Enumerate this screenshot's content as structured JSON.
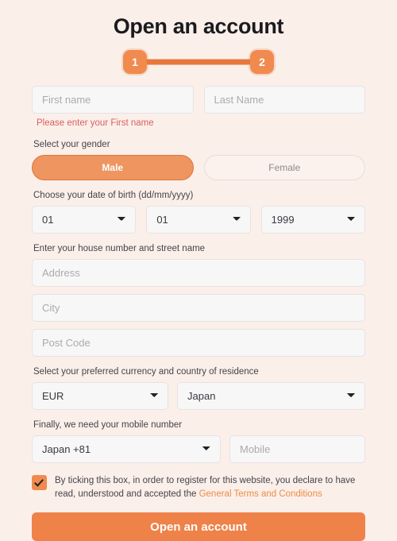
{
  "page": {
    "title": "Open an account",
    "background_color": "#FBEFEA",
    "accent_color": "#EE8248"
  },
  "stepper": {
    "steps": [
      {
        "number": "1",
        "state": "active"
      },
      {
        "number": "2",
        "state": "active"
      }
    ]
  },
  "name_section": {
    "first_name": {
      "placeholder": "First name",
      "value": ""
    },
    "last_name": {
      "placeholder": "Last Name",
      "value": ""
    },
    "error": "Please enter your First name",
    "error_color": "#D9605E"
  },
  "gender_section": {
    "label": "Select your gender",
    "options": [
      {
        "label": "Male",
        "selected": true
      },
      {
        "label": "Female",
        "selected": false
      }
    ]
  },
  "dob_section": {
    "label": "Choose your date of birth (dd/mm/yyyy)",
    "day": "01",
    "month": "01",
    "year": "1999"
  },
  "address_section": {
    "label": "Enter your house number and street name",
    "address": {
      "placeholder": "Address",
      "value": ""
    },
    "city": {
      "placeholder": "City",
      "value": ""
    },
    "post_code": {
      "placeholder": "Post Code",
      "value": ""
    }
  },
  "currency_section": {
    "label": "Select your preferred currency and country of residence",
    "currency": "EUR",
    "country": "Japan"
  },
  "mobile_section": {
    "label": "Finally, we need your mobile number",
    "dial_code": "Japan +81",
    "mobile": {
      "placeholder": "Mobile",
      "value": ""
    }
  },
  "terms_section": {
    "checked": true,
    "text": "By ticking this box, in order to register for this website, you declare to have read, understood and accepted the ",
    "link_label": "General Terms and Conditions",
    "link_color": "#EE8B42"
  },
  "submit": {
    "label": "Open an account"
  }
}
